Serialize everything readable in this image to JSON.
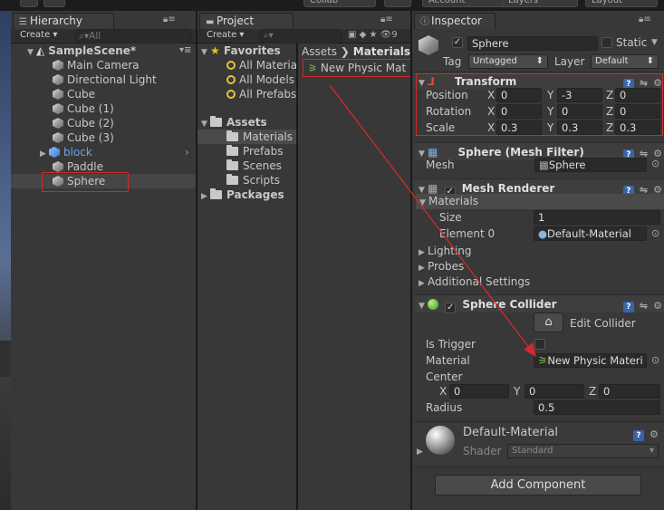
{
  "topbar": {
    "collab": "Collab",
    "account": "Account",
    "layers": "Layers",
    "layout": "Layout"
  },
  "hierarchy": {
    "tab": "Hierarchy",
    "create": "Create",
    "search_placeholder": "All",
    "scene": "SampleScene*",
    "items": [
      "Main Camera",
      "Directional Light",
      "Cube",
      "Cube (1)",
      "Cube (2)",
      "Cube (3)",
      "block",
      "Paddle",
      "Sphere"
    ]
  },
  "project": {
    "tab": "Project",
    "create": "Create",
    "badge": "9",
    "favorites": "Favorites",
    "fav_items": [
      "All Materia",
      "All Models",
      "All Prefabs"
    ],
    "assets": "Assets",
    "asset_items": [
      "Materials",
      "Prefabs",
      "Scenes",
      "Scripts"
    ],
    "packages": "Packages",
    "breadcrumb": [
      "Assets",
      "Materials"
    ],
    "file": "New Physic Mat"
  },
  "inspector": {
    "tab": "Inspector",
    "name": "Sphere",
    "static_label": "Static",
    "tag_label": "Tag",
    "tag_value": "Untagged",
    "layer_label": "Layer",
    "layer_value": "Default",
    "transform": {
      "title": "Transform",
      "rows": [
        {
          "label": "Position",
          "x": "0",
          "y": "-3",
          "z": "0"
        },
        {
          "label": "Rotation",
          "x": "0",
          "y": "0",
          "z": "0"
        },
        {
          "label": "Scale",
          "x": "0.3",
          "y": "0.3",
          "z": "0.3"
        }
      ],
      "axis": [
        "X",
        "Y",
        "Z"
      ]
    },
    "mesh_filter": {
      "title": "Sphere (Mesh Filter)",
      "mesh_label": "Mesh",
      "mesh_value": "Sphere"
    },
    "mesh_renderer": {
      "title": "Mesh Renderer",
      "materials": "Materials",
      "size_label": "Size",
      "size_value": "1",
      "element_label": "Element 0",
      "element_value": "Default-Material",
      "lighting": "Lighting",
      "probes": "Probes",
      "additional": "Additional Settings"
    },
    "sphere_collider": {
      "title": "Sphere Collider",
      "edit_collider": "Edit Collider",
      "is_trigger": "Is Trigger",
      "material_label": "Material",
      "material_value": "New Physic Materi",
      "center_label": "Center",
      "cx": "0",
      "cy": "0",
      "cz": "0",
      "radius_label": "Radius",
      "radius_value": "0.5"
    },
    "material_preview": {
      "name": "Default-Material",
      "shader_label": "Shader",
      "shader_value": "Standard"
    },
    "add_component": "Add Component"
  }
}
